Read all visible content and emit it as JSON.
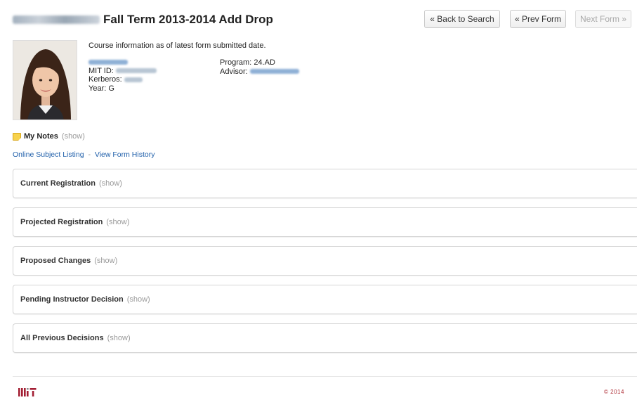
{
  "header": {
    "title": "Fall Term 2013-2014 Add Drop",
    "back_label": "« Back to Search",
    "prev_label": "« Prev Form",
    "next_label": "Next Form »"
  },
  "student": {
    "info_note": "Course information as of latest form submitted date.",
    "mit_id_label": "MIT ID:",
    "kerberos_label": "Kerberos:",
    "year_label": "Year:",
    "year_value": "G",
    "program_label": "Program:",
    "program_value": "24.AD",
    "advisor_label": "Advisor:"
  },
  "notes": {
    "label": "My Notes",
    "toggle": "(show)"
  },
  "links": {
    "subject_listing": "Online Subject Listing",
    "separator": "-",
    "form_history": "View Form History"
  },
  "panels": [
    {
      "title": "Current Registration",
      "toggle": "(show)"
    },
    {
      "title": "Projected Registration",
      "toggle": "(show)"
    },
    {
      "title": "Proposed Changes",
      "toggle": "(show)"
    },
    {
      "title": "Pending Instructor Decision",
      "toggle": "(show)"
    },
    {
      "title": "All Previous Decisions",
      "toggle": "(show)"
    }
  ],
  "footer": {
    "logo_text": "MIT",
    "copyright": "© 2014"
  },
  "colors": {
    "link": "#1f5faa",
    "logo": "#a31f34",
    "muted": "#9a9a9a"
  }
}
